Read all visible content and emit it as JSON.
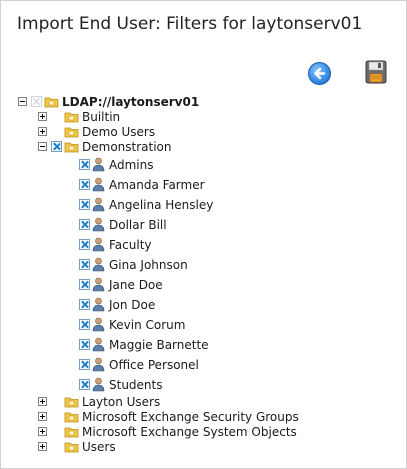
{
  "page": {
    "title": "Import End User: Filters for laytonserv01"
  },
  "toolbar": {
    "back_icon": "back-arrow-icon",
    "save_icon": "floppy-disk-icon"
  },
  "tree": {
    "root": {
      "label": "LDAP://laytonserv01"
    },
    "folders": [
      {
        "label": "Builtin"
      },
      {
        "label": "Demo Users"
      },
      {
        "label": "Demonstration"
      },
      {
        "label": "Layton Users"
      },
      {
        "label": "Microsoft Exchange Security Groups"
      },
      {
        "label": "Microsoft Exchange System Objects"
      },
      {
        "label": "Users"
      }
    ],
    "demonstration_children": [
      {
        "label": "Admins"
      },
      {
        "label": "Amanda Farmer"
      },
      {
        "label": "Angelina Hensley"
      },
      {
        "label": "Dollar Bill"
      },
      {
        "label": "Faculty"
      },
      {
        "label": "Gina Johnson"
      },
      {
        "label": "Jane Doe"
      },
      {
        "label": "Jon Doe"
      },
      {
        "label": "Kevin Corum"
      },
      {
        "label": "Maggie Barnette"
      },
      {
        "label": "Office Personel"
      },
      {
        "label": "Students"
      }
    ]
  },
  "colors": {
    "check": "#1a7fd1",
    "folder": "#f2c744",
    "back_button": "#3b8fe6"
  }
}
